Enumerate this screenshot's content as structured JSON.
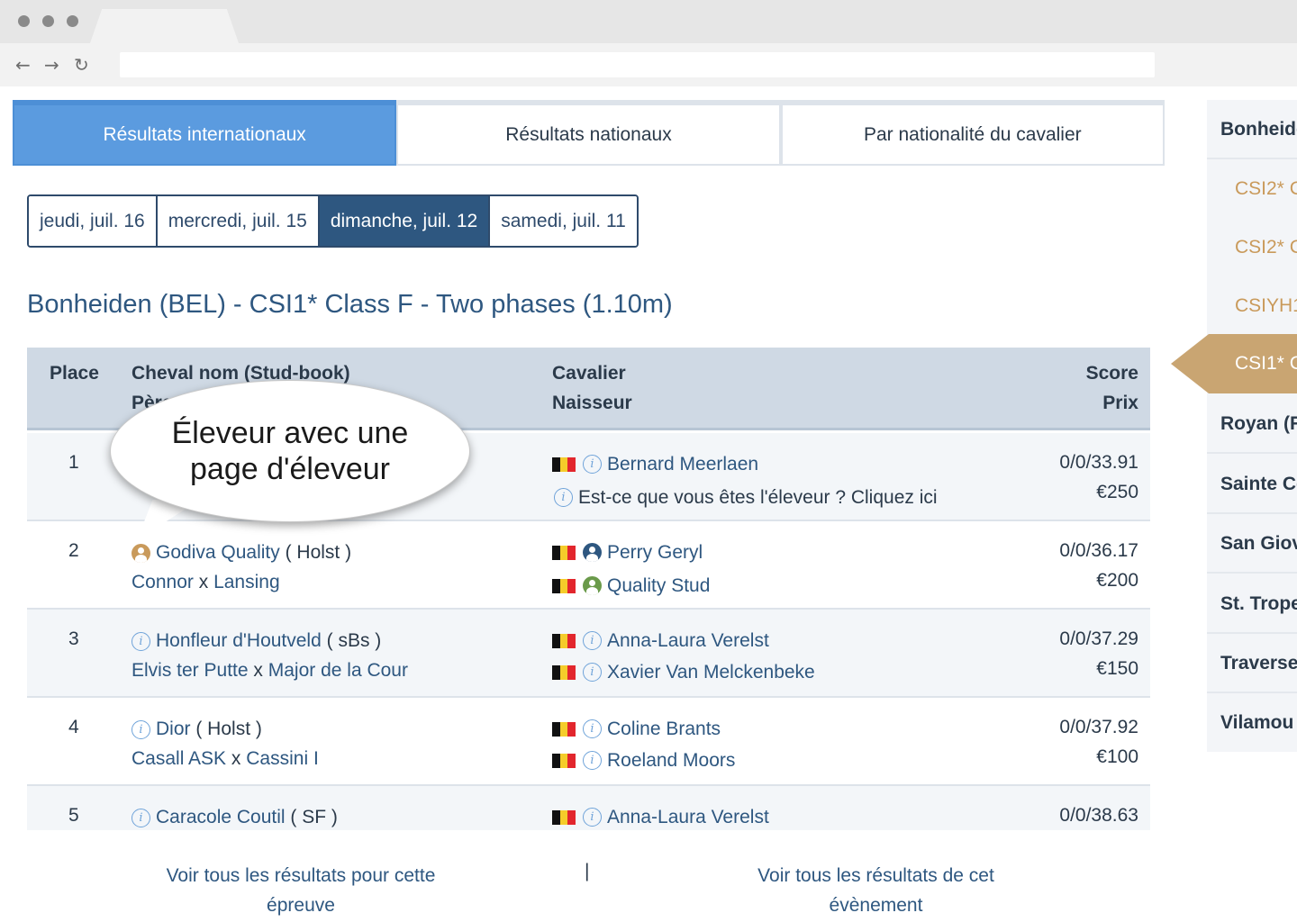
{
  "tabs": [
    "Résultats internationaux",
    "Résultats nationaux",
    "Par nationalité du cavalier"
  ],
  "dates": [
    "jeudi, juil. 16",
    "mercredi, juil. 15",
    "dimanche, juil. 12",
    "samedi, juil. 11"
  ],
  "active_date": "dimanche, juil. 12",
  "class_title": "Bonheiden (BEL) - CSI1* Class F - Two phases (1.10m)",
  "headers": {
    "place": "Place",
    "horse": "Cheval nom (Stud-book)",
    "horse2": "Père",
    "rider": "Cavalier",
    "breeder": "Naisseur",
    "score": "Score",
    "prize": "Prix"
  },
  "callout": "Éleveur avec une page d'éleveur",
  "rows": [
    {
      "place": "1",
      "horse": "",
      "studbook": "",
      "sire": "",
      "dam": "",
      "rider": "Bernard Meerlaen",
      "breeder": "Est-ce que vous êtes l'éleveur ? Cliquez ici",
      "score": "0/0/33.91",
      "prize": "€250"
    },
    {
      "place": "2",
      "horse": "Godiva Quality",
      "studbook": "( Holst )",
      "sire": "Connor",
      "dam": "Lansing",
      "rider": "Perry Geryl",
      "breeder": "Quality Stud",
      "score": "0/0/36.17",
      "prize": "€200"
    },
    {
      "place": "3",
      "horse": "Honfleur d'Houtveld",
      "studbook": "( sBs )",
      "sire": "Elvis ter Putte",
      "dam": "Major de la Cour",
      "rider": "Anna-Laura Verelst",
      "breeder": "Xavier Van Melckenbeke",
      "score": "0/0/37.29",
      "prize": "€150"
    },
    {
      "place": "4",
      "horse": "Dior",
      "studbook": "( Holst )",
      "sire": "Casall ASK",
      "dam": "Cassini I",
      "rider": "Coline Brants",
      "breeder": "Roeland Moors",
      "score": "0/0/37.92",
      "prize": "€100"
    },
    {
      "place": "5",
      "horse": "Caracole Coutil",
      "studbook": "( SF )",
      "sire": "",
      "dam": "",
      "rider": "Anna-Laura Verelst",
      "breeder": "",
      "score": "0/0/38.63",
      "prize": ""
    }
  ],
  "x_sep": "x",
  "footer": {
    "link1": "Voir tous les résultats pour cette épreuve",
    "separator": "|",
    "link2": "Voir tous les résultats de cet évènement"
  },
  "sidebar": {
    "event": "Bonheiden",
    "subs": [
      "CSI2* C",
      "CSI2* C",
      "CSIYH1",
      "CSI1* C"
    ],
    "events": [
      "Royan (F",
      "Sainte Cé",
      "San Giov",
      "St. Trope",
      "Traverse",
      "Vilamou"
    ]
  },
  "colors": {
    "accent": "#5b9bdf",
    "navy": "#2e5780",
    "gold": "#c9a572",
    "breeder_icon": "#6a9a4a",
    "rider_icon": "#2e5780",
    "horse_icon": "#c99a5b"
  }
}
